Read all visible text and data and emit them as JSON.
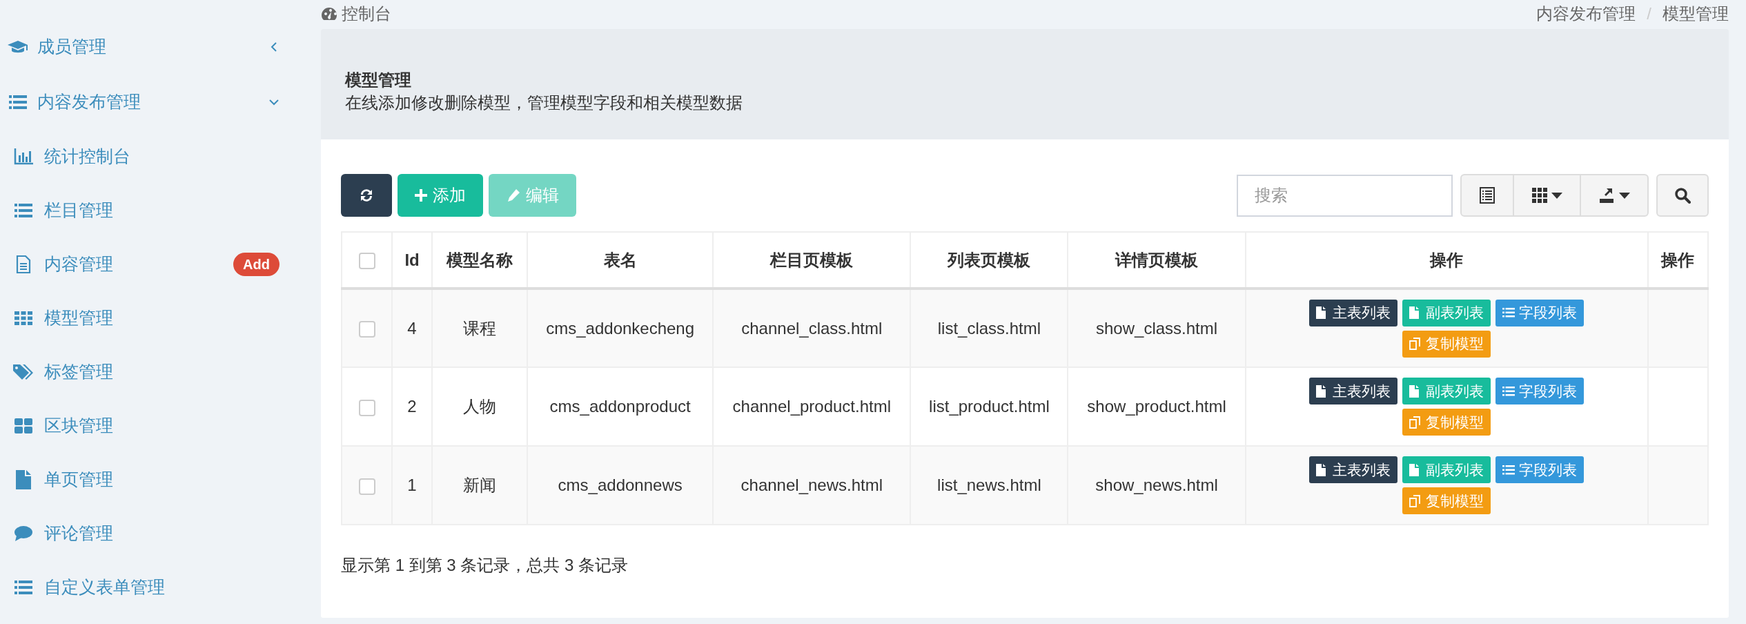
{
  "sidebar": {
    "items": [
      {
        "label": "成员管理",
        "expanded": false
      },
      {
        "label": "内容发布管理",
        "expanded": true,
        "children": [
          {
            "label": "统计控制台"
          },
          {
            "label": "栏目管理"
          },
          {
            "label": "内容管理",
            "badge": "Add"
          },
          {
            "label": "模型管理"
          },
          {
            "label": "标签管理"
          },
          {
            "label": "区块管理"
          },
          {
            "label": "单页管理"
          },
          {
            "label": "评论管理"
          },
          {
            "label": "自定义表单管理"
          }
        ]
      }
    ]
  },
  "page_header": {
    "title": "控制台",
    "breadcrumb": [
      "内容发布管理",
      "模型管理"
    ],
    "breadcrumb_separator": "/"
  },
  "panel": {
    "title": "模型管理",
    "description": "在线添加修改删除模型，管理模型字段和相关模型数据"
  },
  "toolbar": {
    "buttons": [
      {
        "kind": "refresh",
        "disabled": false
      },
      {
        "kind": "add",
        "label": "添加",
        "disabled": false
      },
      {
        "kind": "edit",
        "label": "编辑",
        "disabled": true
      }
    ],
    "search": {
      "placeholder": "搜索"
    }
  },
  "table": {
    "header_checked": false,
    "columns": [
      "Id",
      "模型名称",
      "表名",
      "栏目页模板",
      "列表页模板",
      "详情页模板",
      "操作",
      "操作"
    ],
    "rows": [
      {
        "checked": false,
        "cells": [
          "4",
          "课程",
          "cms_addonkecheng",
          "channel_class.html",
          "list_class.html",
          "show_class.html"
        ],
        "actions": [
          {
            "kind": "main",
            "label": "主表列表"
          },
          {
            "kind": "sub",
            "label": "副表列表"
          },
          {
            "kind": "fields",
            "label": "字段列表"
          },
          {
            "kind": "copy",
            "label": "复制模型"
          }
        ]
      },
      {
        "checked": false,
        "cells": [
          "2",
          "人物",
          "cms_addonproduct",
          "channel_product.html",
          "list_product.html",
          "show_product.html"
        ],
        "actions": [
          {
            "kind": "main",
            "label": "主表列表"
          },
          {
            "kind": "sub",
            "label": "副表列表"
          },
          {
            "kind": "fields",
            "label": "字段列表"
          },
          {
            "kind": "copy",
            "label": "复制模型"
          }
        ]
      },
      {
        "checked": false,
        "cells": [
          "1",
          "新闻",
          "cms_addonnews",
          "channel_news.html",
          "list_news.html",
          "show_news.html"
        ],
        "actions": [
          {
            "kind": "main",
            "label": "主表列表"
          },
          {
            "kind": "sub",
            "label": "副表列表"
          },
          {
            "kind": "fields",
            "label": "字段列表"
          },
          {
            "kind": "copy",
            "label": "复制模型"
          }
        ]
      }
    ]
  },
  "pagination_info": "显示第 1 到第 3 条记录，总共 3 条记录"
}
